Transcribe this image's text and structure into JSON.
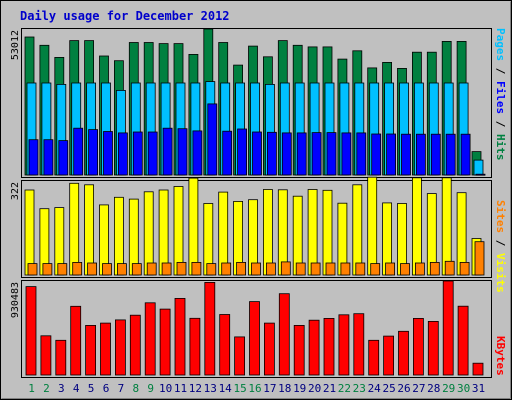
{
  "chart_data": [
    {
      "type": "bar",
      "title": "Daily usage for December 2012",
      "panel": "hits-files-pages",
      "ylabel_parts": [
        "Pages",
        "Files",
        "Hits"
      ],
      "ylabel_separator": " / ",
      "max_label": "53012",
      "ylim": [
        0,
        53012
      ],
      "categories": [
        "1",
        "2",
        "3",
        "4",
        "5",
        "6",
        "7",
        "8",
        "9",
        "10",
        "11",
        "12",
        "13",
        "14",
        "15",
        "16",
        "17",
        "18",
        "19",
        "20",
        "21",
        "22",
        "23",
        "24",
        "25",
        "26",
        "27",
        "28",
        "29",
        "30",
        "31"
      ],
      "weekend_days": [
        "1",
        "2",
        "8",
        "9",
        "15",
        "16",
        "22",
        "23",
        "29",
        "30"
      ],
      "series": [
        {
          "name": "Hits",
          "color": "#008040",
          "values": [
            50100,
            47100,
            42700,
            48800,
            48800,
            43200,
            41500,
            48100,
            48100,
            47700,
            47700,
            43800,
            53000,
            48100,
            39900,
            46800,
            42900,
            48800,
            47100,
            46500,
            46500,
            42100,
            45100,
            38900,
            40900,
            38700,
            44600,
            44600,
            48500,
            48500,
            8500
          ]
        },
        {
          "name": "Files",
          "color": "#00c0ff",
          "values": [
            33400,
            33400,
            32900,
            33400,
            33400,
            33400,
            30700,
            33400,
            33400,
            33400,
            33400,
            33400,
            33900,
            33400,
            33400,
            33400,
            32900,
            33400,
            33400,
            33400,
            33400,
            33400,
            33400,
            33400,
            33400,
            33400,
            33400,
            33400,
            33400,
            33400,
            5400
          ]
        },
        {
          "name": "Pages",
          "color": "#0000ff",
          "values": [
            12800,
            12800,
            12500,
            17000,
            16500,
            15800,
            15300,
            15600,
            15600,
            17000,
            16800,
            16000,
            25800,
            15900,
            16700,
            15600,
            15500,
            15300,
            15300,
            15400,
            15400,
            15300,
            15300,
            14900,
            14900,
            14800,
            14800,
            14800,
            14800,
            14800,
            300
          ]
        }
      ]
    },
    {
      "type": "bar",
      "panel": "sites-visits",
      "ylabel_parts": [
        "Sites",
        "Visits"
      ],
      "ylabel_separator": " / ",
      "max_label": "322",
      "ylim": [
        0,
        322
      ],
      "series": [
        {
          "name": "Visits",
          "color": "#ffff00",
          "values": [
            291,
            227,
            231,
            314,
            309,
            240,
            266,
            260,
            285,
            291,
            303,
            332,
            245,
            284,
            252,
            258,
            293,
            292,
            270,
            293,
            290,
            246,
            309,
            335,
            247,
            245,
            333,
            279,
            333,
            282,
            125
          ]
        },
        {
          "name": "Sites",
          "color": "#ff8000",
          "values": [
            39,
            39,
            39,
            43,
            41,
            39,
            39,
            39,
            41,
            41,
            43,
            43,
            39,
            41,
            43,
            41,
            41,
            45,
            41,
            41,
            41,
            41,
            41,
            39,
            41,
            39,
            41,
            43,
            47,
            43,
            114
          ]
        }
      ]
    },
    {
      "type": "bar",
      "panel": "kbytes",
      "ylabel_parts": [
        "KBytes"
      ],
      "ylabel_separator": "",
      "max_label": "930483",
      "ylim": [
        0,
        930483
      ],
      "series": [
        {
          "name": "KBytes",
          "color": "#ff0000",
          "values": [
            875000,
            388000,
            343000,
            680000,
            491000,
            514000,
            545000,
            592000,
            715000,
            652000,
            758000,
            561000,
            917000,
            599000,
            377000,
            727000,
            514000,
            805000,
            491000,
            542000,
            560000,
            596000,
            607000,
            343000,
            385000,
            433000,
            560000,
            531000,
            930483,
            681000,
            117000
          ]
        }
      ]
    }
  ],
  "colors": {
    "background": "#c0c0c0",
    "panel": "#c0c0c0",
    "title": "#0000cc",
    "weekday_label": "#000080",
    "weekend_label": "#008040",
    "max_label": "#000000"
  }
}
